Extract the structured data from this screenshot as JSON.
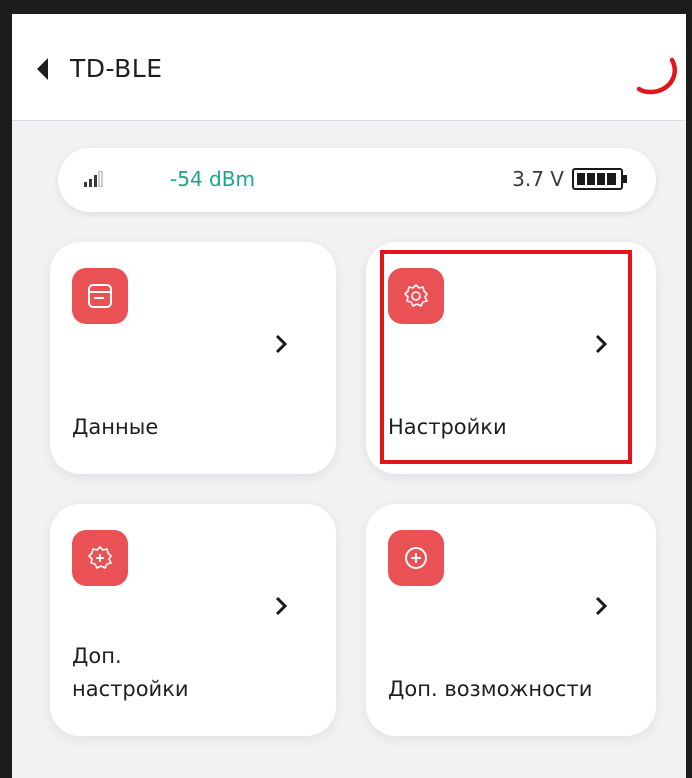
{
  "header": {
    "title": "TD-BLE",
    "back_icon": "chevron-left-icon",
    "loading_icon": "spinner-icon"
  },
  "status": {
    "signal_icon": "signal-strength-icon",
    "signal_text": "-54 dBm",
    "voltage_text": "3.7 V",
    "battery_icon": "battery-full-icon"
  },
  "tiles": [
    {
      "label": "Данные",
      "icon": "document-icon"
    },
    {
      "label": "Настройки",
      "icon": "gear-icon"
    },
    {
      "label_line1": "Доп.",
      "label_line2": "настройки",
      "icon": "gear-plus-icon"
    },
    {
      "label": "Доп. возможности",
      "icon": "plus-circle-icon"
    }
  ],
  "colors": {
    "accent": "#ea5155",
    "signal_green": "#18a88c",
    "highlight": "#e0161c",
    "background": "#f2f2f4"
  }
}
